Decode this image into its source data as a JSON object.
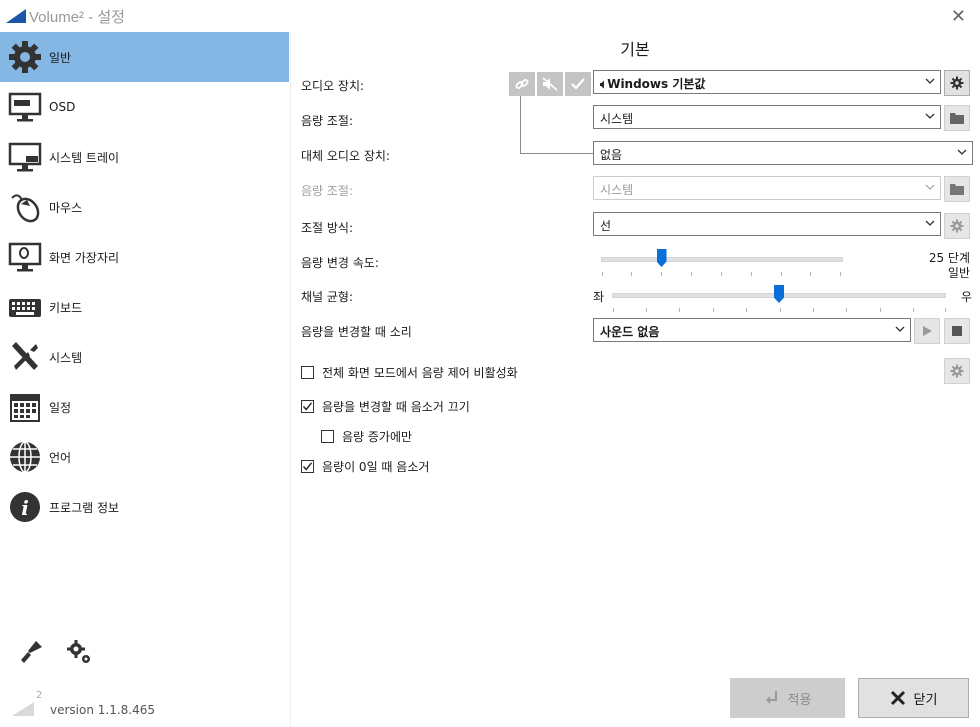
{
  "window": {
    "title": "Volume² - 설정"
  },
  "sidebar": {
    "items": [
      {
        "label": "일반",
        "icon": "gear-icon",
        "active": true
      },
      {
        "label": "OSD",
        "icon": "monitor-osd-icon"
      },
      {
        "label": "시스템 트레이",
        "icon": "monitor-tray-icon"
      },
      {
        "label": "마우스",
        "icon": "mouse-icon"
      },
      {
        "label": "화면 가장자리",
        "icon": "monitor-edge-icon"
      },
      {
        "label": "키보드",
        "icon": "keyboard-icon"
      },
      {
        "label": "시스템",
        "icon": "tools-icon"
      },
      {
        "label": "일정",
        "icon": "calendar-icon"
      },
      {
        "label": "언어",
        "icon": "globe-icon"
      },
      {
        "label": "프로그램 정보",
        "icon": "info-icon"
      }
    ],
    "version": "version 1.1.8.465",
    "logo_sup": "2"
  },
  "main": {
    "title": "기본",
    "audio_device": {
      "label": "오디오 장치:",
      "value": "Windows 기본값",
      "prefix_icon": "speaker-icon"
    },
    "volume_control": {
      "label": "음량 조절:",
      "value": "시스템"
    },
    "alt_audio_device": {
      "label": "대체 오디오 장치:",
      "value": "없음"
    },
    "alt_volume_control": {
      "label": "음량 조절:",
      "value": "시스템",
      "disabled": true
    },
    "adjust_method": {
      "label": "조절 방식:",
      "value": "선"
    },
    "change_speed": {
      "label": "음량 변경 속도:",
      "value_line1": "25 단계",
      "value_line2": "일반",
      "level": 0.25
    },
    "balance": {
      "label": "채널 균형:",
      "left": "좌",
      "right": "우",
      "level": 0.5
    },
    "change_sound": {
      "label": "음량을 변경할 때 소리",
      "value": "사운드 없음"
    },
    "checkboxes": [
      {
        "label": "전체 화면 모드에서 음량 제어 비활성화",
        "checked": false
      },
      {
        "label": "음량을 변경할 때 음소거 끄기",
        "checked": true
      },
      {
        "label": "음량 증가에만",
        "checked": false
      },
      {
        "label": "음량이 0일 때 음소거",
        "checked": true
      }
    ]
  },
  "buttons": {
    "apply": "적용",
    "close": "닫기"
  },
  "colors": {
    "accent": "#0a6fd6",
    "sidebar_active": "#85b7e5"
  }
}
